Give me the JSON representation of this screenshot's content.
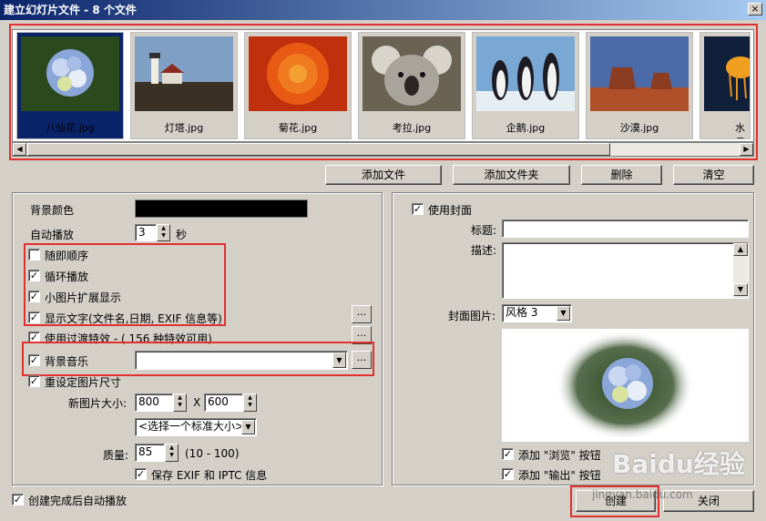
{
  "window": {
    "title": "建立幻灯片文件 - 8 个文件",
    "close_label": "×"
  },
  "thumbnails": [
    {
      "caption": "八仙花.jpg",
      "selected": true,
      "icon": "hydrangea-photo"
    },
    {
      "caption": "灯塔.jpg",
      "selected": false,
      "icon": "lighthouse-photo"
    },
    {
      "caption": "菊花.jpg",
      "selected": false,
      "icon": "chrysanthemum-photo"
    },
    {
      "caption": "考拉.jpg",
      "selected": false,
      "icon": "koala-photo"
    },
    {
      "caption": "企鹅.jpg",
      "selected": false,
      "icon": "penguins-photo"
    },
    {
      "caption": "沙漠.jpg",
      "selected": false,
      "icon": "desert-photo"
    },
    {
      "caption": "水母",
      "selected": false,
      "icon": "jellyfish-photo"
    }
  ],
  "file_buttons": {
    "add_file": "添加文件",
    "add_folder": "添加文件夹",
    "delete": "删除",
    "clear": "清空"
  },
  "left": {
    "bg_color_label": "背景颜色",
    "autoplay_label": "自动播放",
    "autoplay_value": "3",
    "autoplay_unit": "秒",
    "random_order": {
      "label": "随即顺序",
      "checked": false
    },
    "loop_play": {
      "label": "循环播放",
      "checked": true
    },
    "thumb_expand": {
      "label": "小图片扩展显示",
      "checked": true
    },
    "show_text": {
      "label": "显示文字(文件名,日期, EXIF 信息等)",
      "checked": true
    },
    "transition": {
      "label": "使用过渡特效 - ( 156 种特效可用)",
      "checked": true
    },
    "bg_music": {
      "label": "背景音乐",
      "checked": true,
      "value": ""
    },
    "resize": {
      "label": "重设定图片尺寸",
      "checked": true
    },
    "new_size_label": "新图片大小:",
    "width_value": "800",
    "x_label": "X",
    "height_value": "600",
    "std_size_select": "<选择一个标准大小>",
    "quality_label": "质量:",
    "quality_value": "85",
    "quality_range": "(10 - 100)",
    "keep_exif": {
      "label": "保存 EXIF 和 IPTC 信息",
      "checked": true
    },
    "dots_label": "..."
  },
  "right": {
    "use_cover": {
      "label": "使用封面",
      "checked": true
    },
    "title_label": "标题:",
    "title_value": "",
    "desc_label": "描述:",
    "cover_image_label": "封面图片:",
    "cover_style": "风格 3",
    "add_browse": {
      "label": "添加 \"浏览\" 按钮",
      "checked": true
    },
    "add_export": {
      "label": "添加 \"输出\" 按钮",
      "checked": true
    }
  },
  "footer": {
    "autoplay_after": {
      "label": "创建完成后自动播放",
      "checked": true
    },
    "create_label": "创建",
    "close_label": "关闭"
  },
  "watermark": {
    "brand": "Baidu经验",
    "url": "jingyan.baidu.com"
  },
  "colors": {
    "highlight_red": "#e03030",
    "title_blue": "#0a246a",
    "dialog_gray": "#d4d0c8"
  }
}
